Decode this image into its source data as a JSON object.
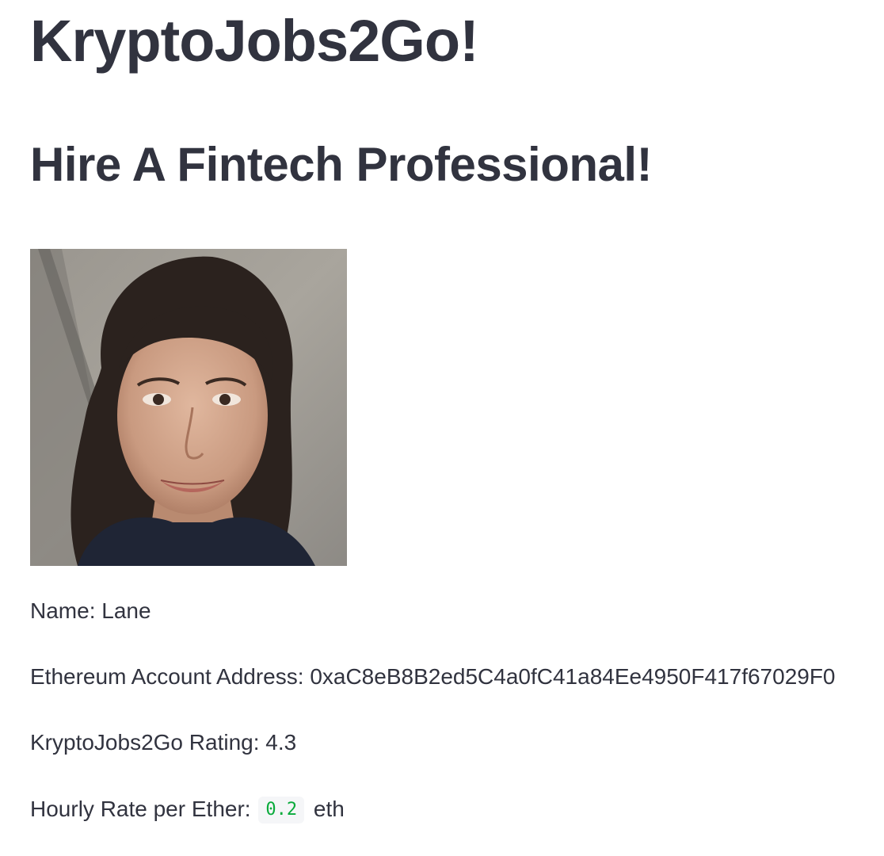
{
  "app": {
    "title": "KryptoJobs2Go!",
    "subtitle": "Hire A Fintech Professional!"
  },
  "candidate": {
    "photo_icon": "candidate-photo",
    "name_label": "Name: ",
    "name_value": "Lane",
    "address_label": "Ethereum Account Address: ",
    "address_value": "0xaC8eB8B2ed5C4a0fC41a84Ee4950F417f67029F0",
    "rating_label": "KryptoJobs2Go Rating: ",
    "rating_value": "4.3",
    "rate_label": "Hourly Rate per Ether: ",
    "rate_value": "0.2",
    "rate_unit": " eth"
  },
  "colors": {
    "text": "#31333f",
    "code_text": "#09ab3b",
    "code_bg": "#f5f6f8"
  }
}
